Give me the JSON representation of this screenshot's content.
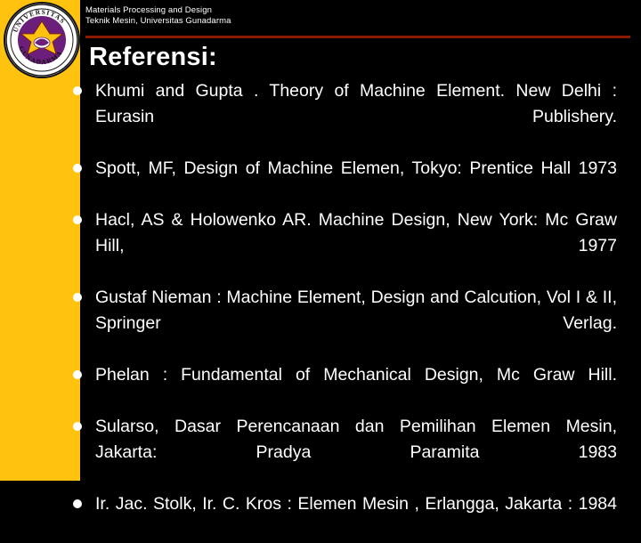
{
  "header": {
    "line1": "Materials Processing and Design",
    "line2": "Teknik Mesin, Universitas Gunadarma",
    "rule_color": "#8B1A00"
  },
  "logo": {
    "name": "gunadarma-university-seal",
    "top_text": "UNIVERSITAS",
    "bottom_text": "GUNADARMA"
  },
  "title": "Referensi:",
  "theme": {
    "background": "#000000",
    "sidebar": "#FFC20E",
    "text": "#FFFFFF"
  },
  "references": [
    "Khumi and Gupta . Theory of Machine Element. New Delhi : Eurasin Publishery.",
    "Spott, MF, Design of Machine Elemen, Tokyo: Prentice Hall 1973",
    "Hacl, AS & Holowenko AR. Machine Design, New York: Mc Graw Hill, 1977",
    "Gustaf Nieman : Machine Element, Design and Calcution, Vol I & II, Springer Verlag.",
    "Phelan : Fundamental of Mechanical Design, Mc Graw Hill.",
    "Sularso, Dasar Perencanaan dan Pemilihan Elemen Mesin, Jakarta: Pradya Paramita 1983",
    "Ir. Jac. Stolk, Ir. C. Kros : Elemen Mesin , Erlangga, Jakarta : 1984"
  ]
}
